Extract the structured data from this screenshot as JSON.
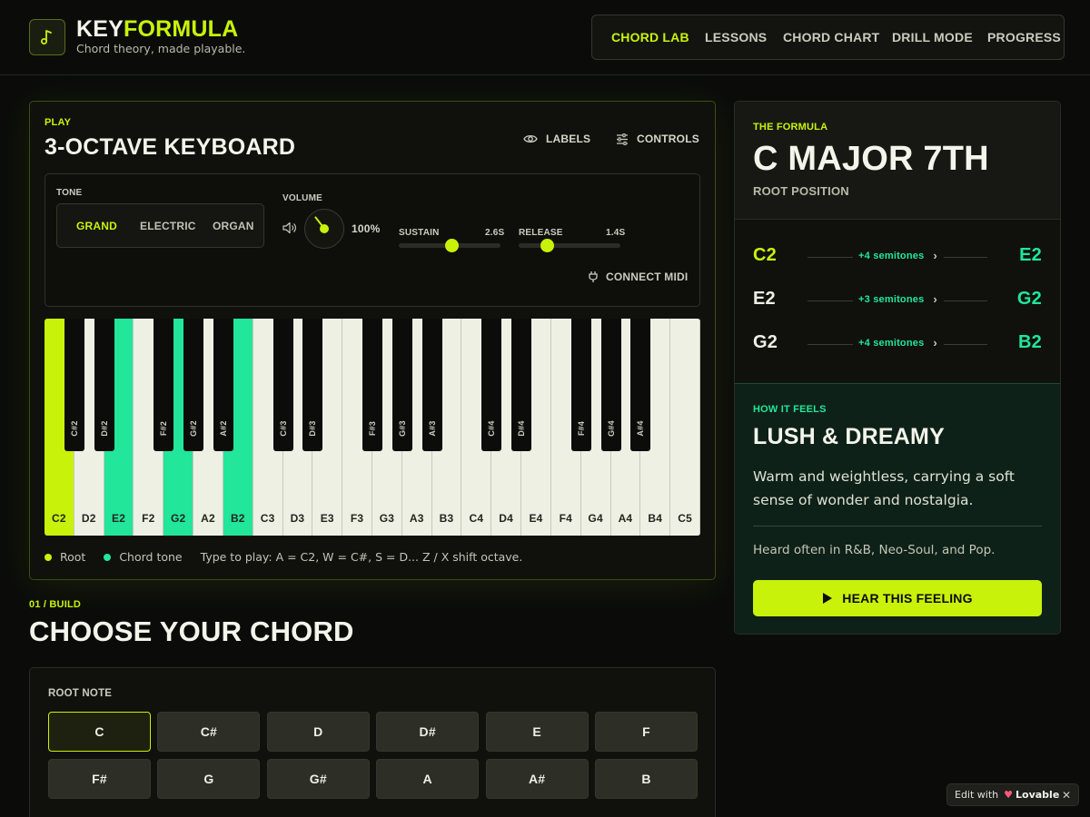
{
  "header": {
    "brand_part1": "KEY",
    "brand_part2": "FORMULA",
    "tagline": "Chord theory, made playable.",
    "logo_icon": "music-note-icon",
    "nav": [
      {
        "label": "CHORD LAB",
        "active": true
      },
      {
        "label": "LESSONS",
        "active": false
      },
      {
        "label": "CHORD CHART",
        "active": false
      },
      {
        "label": "DRILL MODE",
        "active": false
      },
      {
        "label": "PROGRESS",
        "active": false
      }
    ]
  },
  "play": {
    "eyebrow": "PLAY",
    "title": "3-OCTAVE KEYBOARD",
    "labels_btn": "LABELS",
    "controls_btn": "CONTROLS",
    "tone_label": "TONE",
    "tones": [
      "GRAND",
      "ELECTRIC",
      "ORGAN"
    ],
    "tone_selected": "GRAND",
    "volume_label": "VOLUME",
    "volume_value": "100%",
    "volume_level": 1.0,
    "sustain_label": "SUSTAIN",
    "sustain_value": "2.6S",
    "sustain_level": 0.52,
    "release_label": "RELEASE",
    "release_value": "1.4S",
    "release_level": 0.28,
    "connect_midi": "CONNECT MIDI",
    "white_keys": [
      "C2",
      "D2",
      "E2",
      "F2",
      "G2",
      "A2",
      "B2",
      "C3",
      "D3",
      "E3",
      "F3",
      "G3",
      "A3",
      "B3",
      "C4",
      "D4",
      "E4",
      "F4",
      "G4",
      "A4",
      "B4",
      "C5"
    ],
    "black_keys": [
      "C#2",
      "D#2",
      "F#2",
      "G#2",
      "A#2",
      "C#3",
      "D#3",
      "F#3",
      "G#3",
      "A#3",
      "C#4",
      "D#4",
      "F#4",
      "G#4",
      "A#4"
    ],
    "root_keys": [
      "C2"
    ],
    "chord_keys": [
      "E2",
      "G2",
      "B2"
    ],
    "legend_root": "Root",
    "legend_chord": "Chord tone",
    "hint": "Type to play: A = C2, W = C#, S = D... Z / X shift octave."
  },
  "build": {
    "eyebrow": "01 / BUILD",
    "title": "CHOOSE YOUR CHORD",
    "root_label": "ROOT NOTE",
    "notes": [
      "C",
      "C#",
      "D",
      "D#",
      "E",
      "F",
      "F#",
      "G",
      "G#",
      "A",
      "A#",
      "B"
    ],
    "selected": "C"
  },
  "formula": {
    "eyebrow": "THE FORMULA",
    "title": "C MAJOR 7TH",
    "subtitle": "ROOT POSITION",
    "intervals": [
      {
        "from": "C2",
        "step": "+4 semitones",
        "to": "E2"
      },
      {
        "from": "E2",
        "step": "+3 semitones",
        "to": "G2"
      },
      {
        "from": "G2",
        "step": "+4 semitones",
        "to": "B2"
      }
    ],
    "feel_eyebrow": "HOW IT FEELS",
    "feel_title": "LUSH & DREAMY",
    "feel_desc": "Warm and weightless, carrying a soft sense of wonder and nostalgia.",
    "heard": "Heard often in R&B, Neo-Soul, and Pop.",
    "hear_btn": "HEAR THIS FEELING"
  },
  "badge": {
    "edit_with": "Edit with",
    "brand": "Lovable"
  },
  "colors": {
    "accent": "#c8f20a",
    "chord": "#22e69a",
    "background": "#0b0c0a"
  }
}
